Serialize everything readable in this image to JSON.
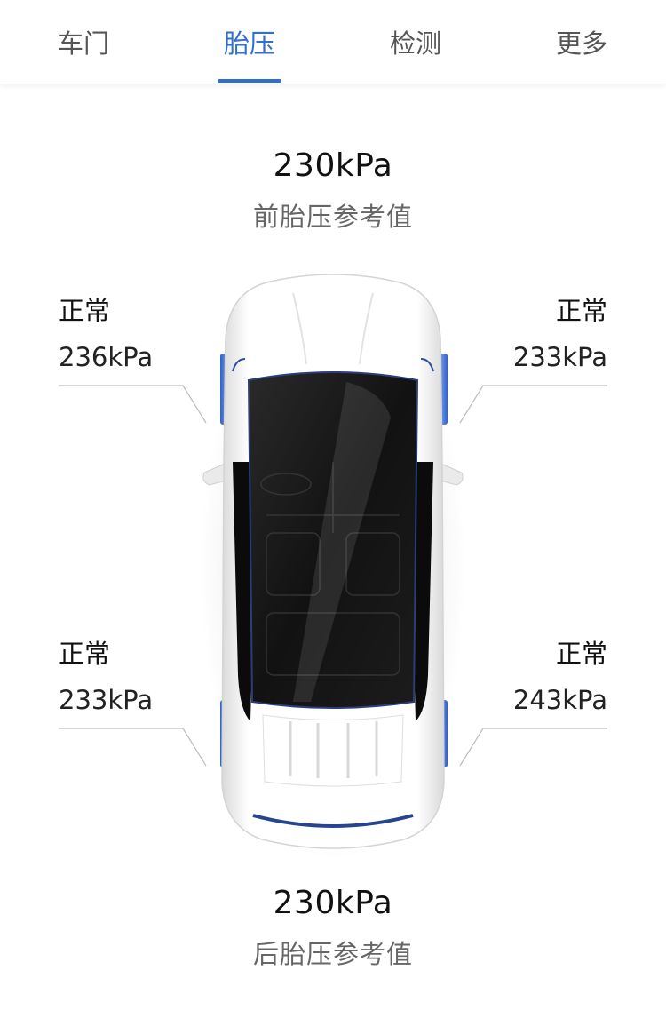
{
  "tabs": [
    {
      "label": "车门"
    },
    {
      "label": "胎压"
    },
    {
      "label": "检测"
    },
    {
      "label": "更多"
    }
  ],
  "active_tab": "胎压",
  "front_reference": {
    "value": "230kPa",
    "label": "前胎压参考值"
  },
  "rear_reference": {
    "value": "230kPa",
    "label": "后胎压参考值"
  },
  "tires": {
    "front_left": {
      "status": "正常",
      "pressure": "236kPa"
    },
    "front_right": {
      "status": "正常",
      "pressure": "233kPa"
    },
    "rear_left": {
      "status": "正常",
      "pressure": "233kPa"
    },
    "rear_right": {
      "status": "正常",
      "pressure": "243kPa"
    }
  },
  "colors": {
    "accent": "#2f6fd1",
    "tire_indicator": "#3a6fd8",
    "car_body": "#f7f7f7",
    "glass": "#141414"
  }
}
